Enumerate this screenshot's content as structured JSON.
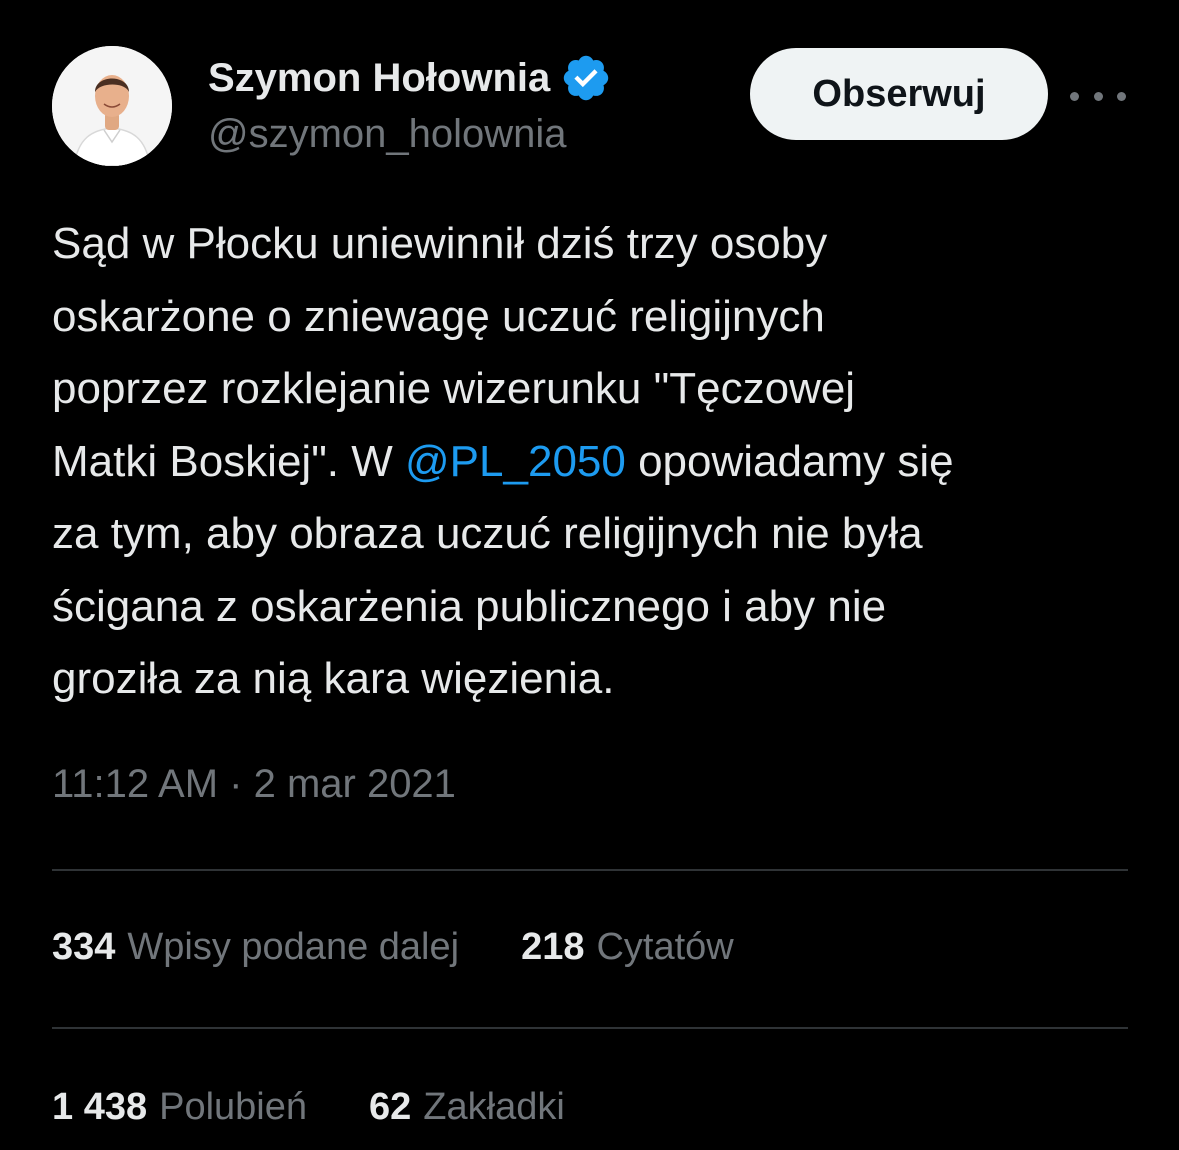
{
  "author": {
    "display_name": "Szymon Hołownia",
    "handle": "@szymon_holownia",
    "avatar_icon": "profile-photo",
    "verified_icon": "verified-badge-icon",
    "verified_color": "#1d9bf0"
  },
  "header": {
    "follow_label": "Obserwuj",
    "more_icon": "more-horizontal-icon"
  },
  "tweet": {
    "lines": [
      {
        "text": "Sąd w Płocku uniewinnił dziś trzy osoby"
      },
      {
        "text": "oskarżone o zniewagę uczuć religijnych"
      },
      {
        "text": "poprzez rozklejanie wizerunku \"Tęczowej"
      },
      {
        "before": "Matki Boskiej\". W ",
        "mention": "@PL_2050",
        "after": " opowiadamy się"
      },
      {
        "text": "za tym, aby obraza uczuć religijnych nie była"
      },
      {
        "text": "ścigana z oskarżenia publicznego i aby nie"
      },
      {
        "text": "groziła za nią kara więzienia."
      }
    ],
    "mention_color": "#1d9bf0",
    "timestamp": "11:12 AM · 2 mar 2021"
  },
  "stats": {
    "row1": [
      {
        "count": "334",
        "label": "Wpisy podane dalej"
      },
      {
        "count": "218",
        "label": "Cytatów"
      }
    ],
    "row2": [
      {
        "count": "1 438",
        "label": "Polubień"
      },
      {
        "count": "62",
        "label": "Zakładki"
      }
    ]
  },
  "colors": {
    "background": "#000000",
    "text_primary": "#e7e9ea",
    "text_secondary": "#71767b",
    "divider": "#2f3336",
    "button_bg": "#eff3f4"
  }
}
